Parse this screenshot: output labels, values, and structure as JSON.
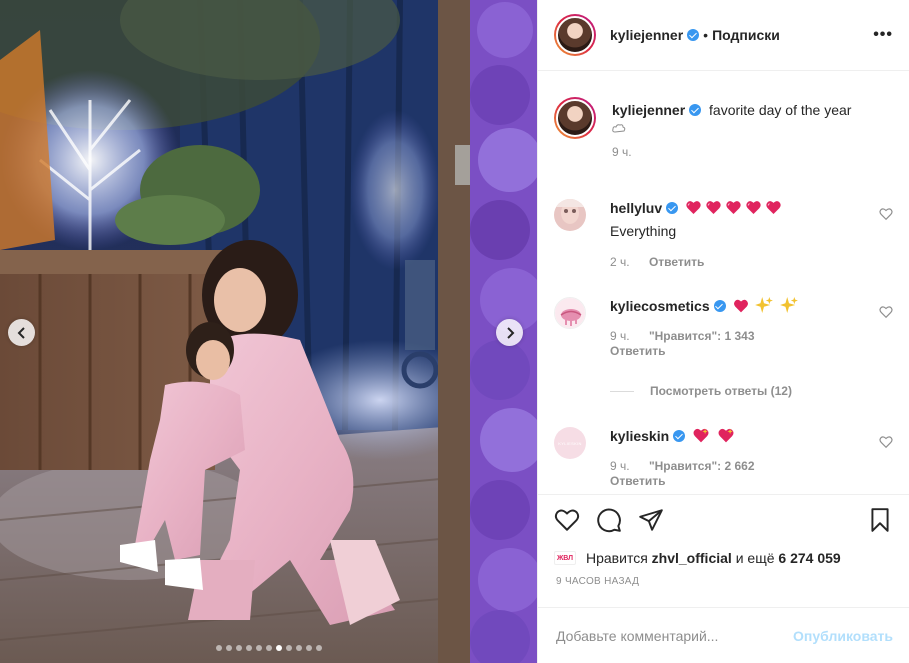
{
  "post": {
    "image_alt": "Photo of a woman and a child in sparkly pink outfits hugging",
    "active_slide": 7,
    "slide_count": 11
  },
  "header": {
    "username": "kyliejenner",
    "separator": "•",
    "follow_label": "Подписки",
    "more_icon": "more-horizontal-icon"
  },
  "caption": {
    "username": "kyliejenner",
    "text": "favorite day of the year",
    "time": "9 ч."
  },
  "comments": [
    {
      "username": "hellyluv",
      "text": "Everything",
      "time": "2 ч.",
      "reply_label": "Ответить",
      "emoji_count": 5,
      "emoji_type": "red-heart"
    },
    {
      "username": "kyliecosmetics",
      "time": "9 ч.",
      "likes_label": "\"Нравится\": 1 343",
      "reply_label": "Ответить",
      "view_replies_label": "Посмотреть ответы (12)",
      "emoji_type": "heart-sparkles"
    },
    {
      "username": "kylieskin",
      "time": "9 ч.",
      "likes_label": "\"Нравится\": 2 662",
      "reply_label": "Ответить",
      "emoji_type": "sparkling-hearts",
      "avatar_text": "KYLIESKIN"
    }
  ],
  "likes": {
    "prefix": "Нравится",
    "user": "zhvl_official",
    "middle": "и ещё",
    "count": "6 274 059",
    "mini_avatar_text": "ЖВЛ"
  },
  "posted": "9 ЧАСОВ НАЗАД",
  "add_comment": {
    "placeholder": "Добавьте комментарий...",
    "publish_label": "Опубликовать"
  },
  "colors": {
    "verified": "#3897f0",
    "publish_disabled": "#b2dffc",
    "secondary_text": "#8e8e8e",
    "border": "#efefef"
  }
}
